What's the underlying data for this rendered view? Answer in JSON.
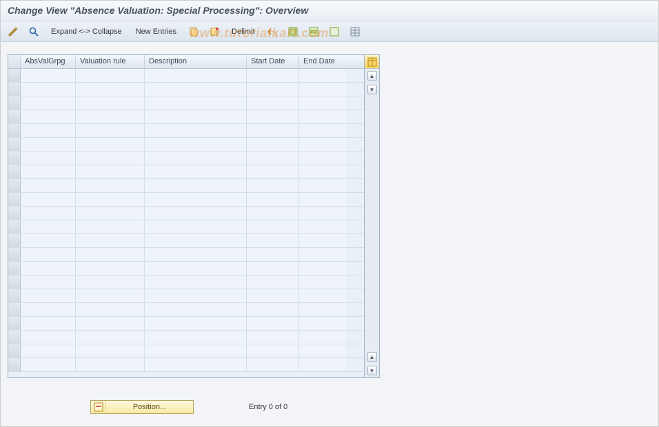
{
  "header": {
    "title": "Change View \"Absence Valuation: Special Processing\": Overview"
  },
  "toolbar": {
    "expand_collapse": "Expand <-> Collapse",
    "new_entries": "New Entries",
    "delimit": "Delimit"
  },
  "table": {
    "columns": [
      "AbsValGrpg",
      "Valuation rule",
      "Description",
      "Start Date",
      "End Date"
    ],
    "rows": []
  },
  "footer": {
    "position_label": "Position...",
    "entry_text": "Entry 0 of 0"
  },
  "watermark": "www.tutorialkart.com"
}
